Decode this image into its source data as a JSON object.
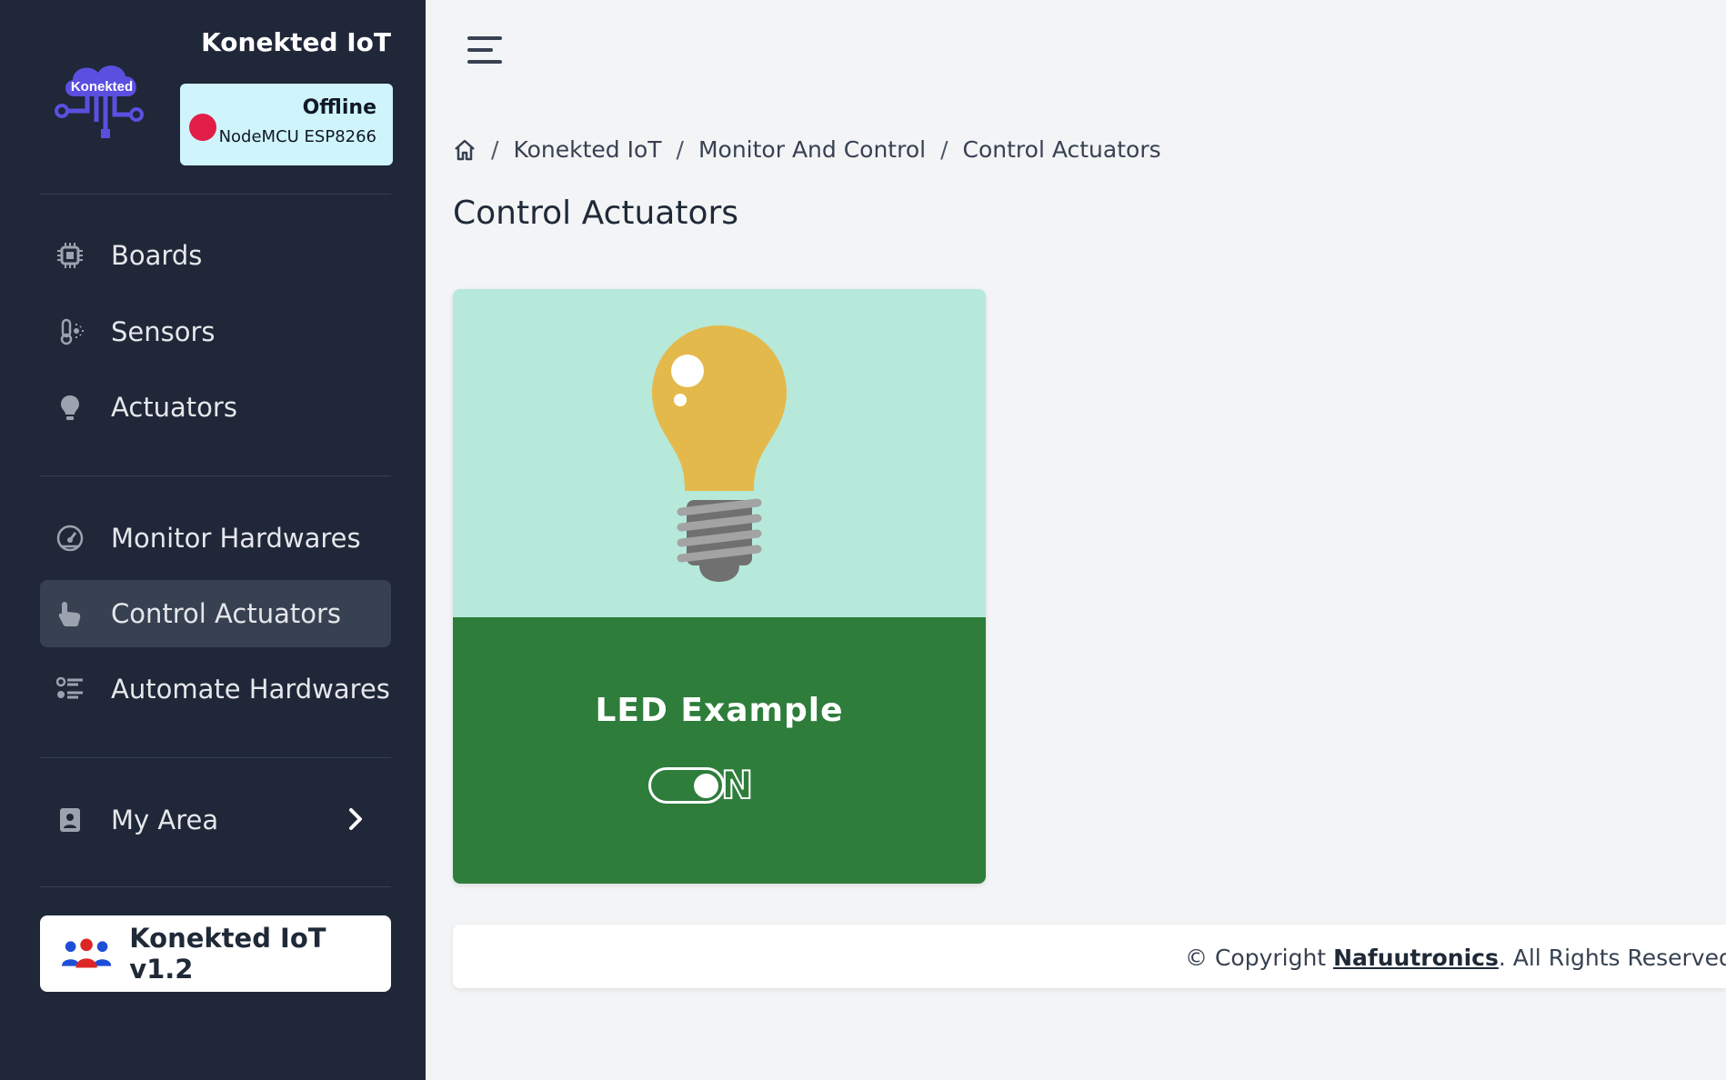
{
  "app": {
    "title": "Konekted IoT",
    "logo_text": "Konekted"
  },
  "device": {
    "status": "Offline",
    "board": "NodeMCU ESP8266",
    "status_color": "#e11d48"
  },
  "sidebar": {
    "items": [
      {
        "label": "Boards",
        "icon": "chip-icon"
      },
      {
        "label": "Sensors",
        "icon": "thermometer-icon"
      },
      {
        "label": "Actuators",
        "icon": "lightbulb-icon"
      },
      {
        "label": "Monitor Hardwares",
        "icon": "gauge-icon"
      },
      {
        "label": "Control Actuators",
        "icon": "hand-pointer-icon",
        "active": true
      },
      {
        "label": "Automate Hardwares",
        "icon": "list-icon"
      },
      {
        "label": "My Area",
        "icon": "id-badge-icon"
      }
    ],
    "version_label": "Konekted IoT v1.2"
  },
  "breadcrumb": [
    "Konekted IoT",
    "Monitor And Control",
    "Control Actuators"
  ],
  "page_title": "Control Actuators",
  "actuator": {
    "name": "LED Example",
    "state_label": "N",
    "on": true
  },
  "footer": {
    "prefix": "© Copyright ",
    "company": "Nafuutronics",
    "suffix": ". All Rights Reserved. IT"
  },
  "colors": {
    "sidebar_bg": "#1f2738",
    "card_top": "#b6e9da",
    "card_bottom": "#2e7d3b",
    "accent_logo": "#4f46e5"
  }
}
